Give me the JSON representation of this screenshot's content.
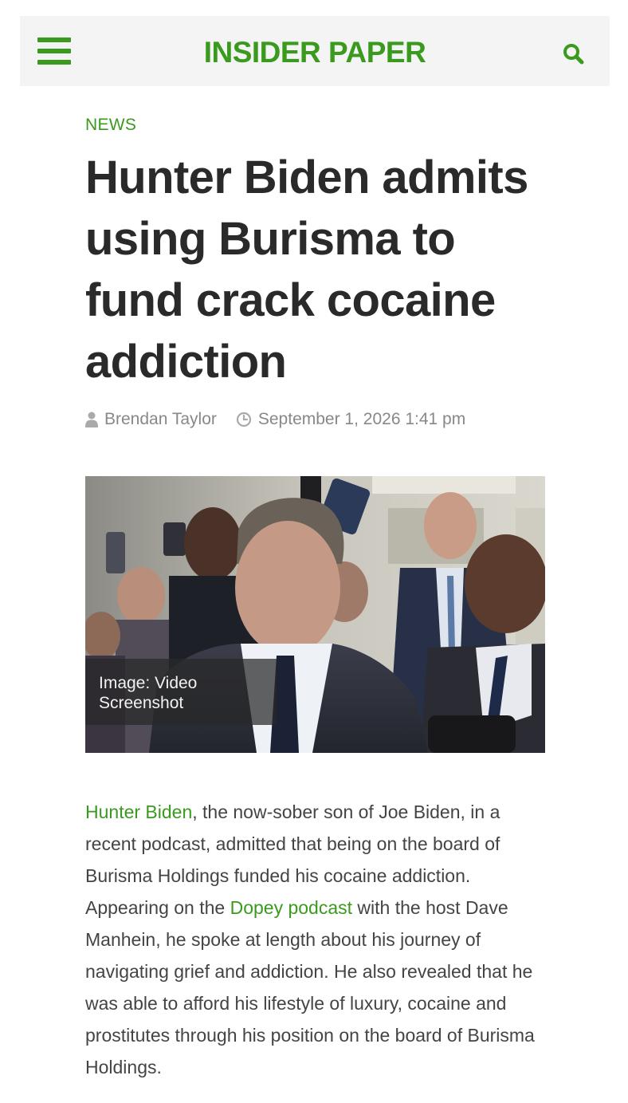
{
  "header": {
    "site_title": "INSIDER PAPER",
    "menu_icon": "hamburger-menu-icon",
    "search_icon": "search-icon",
    "accent_color": "#3a9a1e"
  },
  "article": {
    "category": "NEWS",
    "title": "Hunter Biden admits using Burisma to fund crack cocaine addiction",
    "author": "Brendan Taylor",
    "author_icon": "user-icon",
    "date": "September 1, 2026 1:41 pm",
    "date_icon": "clock-icon",
    "image_caption": "Image: Video Screenshot",
    "body": {
      "link1": "Hunter Biden",
      "text1": ", the now-sober son of Joe Biden, in a recent podcast, admitted that being on the board of Burisma Holdings funded his cocaine addiction. Appearing on the ",
      "link2": "Dopey podcast",
      "text2": " with the host Dave Manhein, he spoke at length about his journey of navigating grief and addiction. He also revealed that he was able to afford his lifestyle of luxury, cocaine and prostitutes through his position on the board of Burisma Holdings."
    }
  }
}
